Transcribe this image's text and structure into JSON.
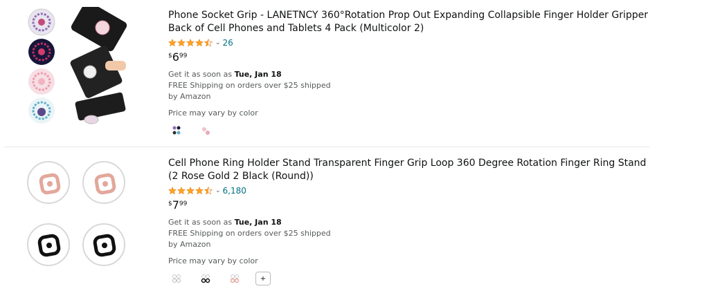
{
  "colors": {
    "link": "#007185",
    "star": "#ffa41c",
    "text": "#0f1111",
    "muted": "#565959"
  },
  "results": [
    {
      "title": "Phone Socket Grip - LANETNCY 360°Rotation Prop Out Expanding Collapsible Finger Holder Gripper Back of Cell Phones and Tablets 4 Pack (Multicolor 2)",
      "rating_stars": 4.5,
      "review_count": "26",
      "price": {
        "symbol": "$",
        "whole": "6",
        "fraction": "99"
      },
      "delivery_prefix": "Get it as soon as",
      "delivery_date": "Tue, Jan 18",
      "shipping": "FREE Shipping on orders over $25 shipped",
      "seller": "by Amazon",
      "price_vary": "Price may vary by color",
      "swatches": [
        "multicolor-swatch",
        "pink-swatch"
      ],
      "image": "phone-socket-grips-image"
    },
    {
      "title": "Cell Phone Ring Holder Stand Transparent Finger Grip Loop 360 Degree Rotation Finger Ring Stand (2 Rose Gold 2 Black (Round))",
      "rating_stars": 4.5,
      "review_count": "6,180",
      "price": {
        "symbol": "$",
        "whole": "7",
        "fraction": "99"
      },
      "delivery_prefix": "Get it as soon as",
      "delivery_date": "Tue, Jan 18",
      "shipping": "FREE Shipping on orders over $25 shipped",
      "seller": "by Amazon",
      "price_vary": "Price may vary by color",
      "swatches": [
        "clear-swatch",
        "black-swatch",
        "rose-swatch"
      ],
      "more_label": "+",
      "image": "ring-holders-image"
    }
  ]
}
